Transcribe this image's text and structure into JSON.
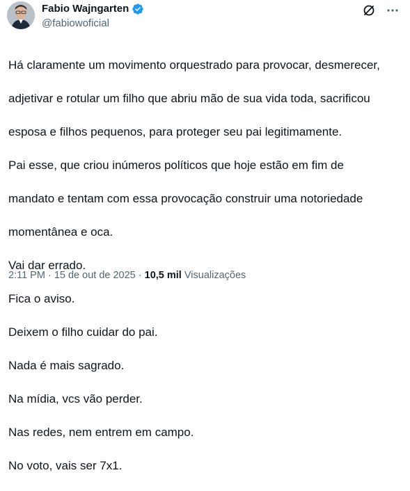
{
  "author": {
    "display_name": "Fabio Wajngarten",
    "handle": "@fabiowoficial",
    "verified": true,
    "verified_color": "#1d9bf0"
  },
  "actions": {
    "grok_icon": "grok-icon",
    "more_icon": "more-icon"
  },
  "tweet": {
    "lines": [
      "Há claramente um movimento orquestrado para provocar, desmerecer,",
      "adjetivar e rotular um filho que abriu mão de sua vida toda, sacrificou",
      "esposa e filhos pequenos, para proteger seu pai legitimamente.",
      "Pai esse, que criou inúmeros políticos que hoje estão em fim de",
      "mandato e tentam com essa provocação construir uma notoriedade",
      "momentânea e oca.",
      "Vai dar errado.",
      "Fica o aviso.",
      "Deixem o filho cuidar do pai.",
      "Nada é mais sagrado.",
      "Na mídia, vcs vão perder.",
      "Nas redes, nem entrem em campo.",
      "No voto, vais ser 7x1."
    ]
  },
  "meta": {
    "time": "2:11 PM",
    "separator": " · ",
    "date": "15 de out de 2025",
    "views_count": "10,5 mil",
    "views_label": "Visualizações"
  }
}
